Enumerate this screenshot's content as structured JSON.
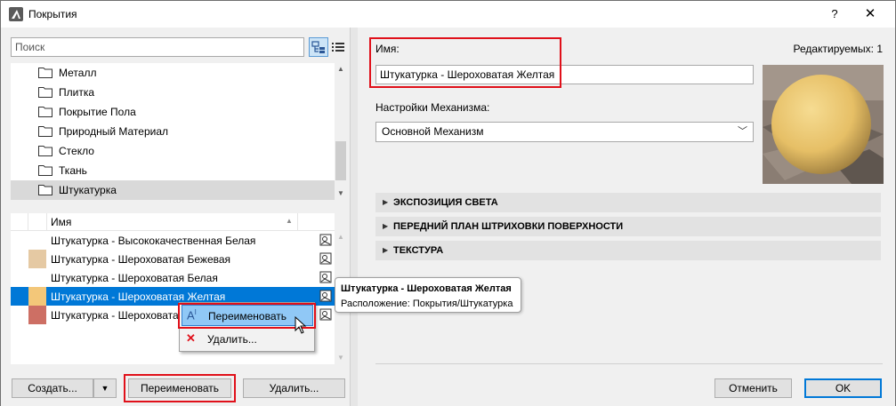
{
  "window": {
    "title": "Покрытия",
    "help_label": "?",
    "close_label": "✕"
  },
  "left": {
    "search_placeholder": "Поиск",
    "folders": [
      "Металл",
      "Плитка",
      "Покрытие Пола",
      "Природный Материал",
      "Стекло",
      "Ткань",
      "Штукатурка"
    ],
    "selected_folder": "Штукатурка",
    "list_header": "Имя",
    "items": [
      {
        "label": "Штукатурка - Высококачественная Белая",
        "color": "#ffffff"
      },
      {
        "label": "Штукатурка - Шероховатая Бежевая",
        "color": "#e5c9a3"
      },
      {
        "label": "Штукатурка - Шероховатая Белая",
        "color": "#ffffff"
      },
      {
        "label": "Штукатурка - Шероховатая Желтая",
        "color": "#f3c779"
      },
      {
        "label": "Штукатурка - Шероховатая",
        "color": "#cd6f64"
      }
    ],
    "selected_item": "Штукатурка - Шероховатая Желтая",
    "buttons": {
      "create": "Создать...",
      "rename": "Переименовать",
      "delete": "Удалить..."
    }
  },
  "right": {
    "name_label": "Имя:",
    "editable_label": "Редактируемых: 1",
    "name_value": "Штукатурка - Шероховатая Желтая",
    "engine_label": "Настройки Механизма:",
    "engine_value": "Основной Механизм",
    "sections": [
      "ЭКСПОЗИЦИЯ СВЕТА",
      "ПЕРЕДНИЙ ПЛАН ШТРИХОВКИ ПОВЕРХНОСТИ",
      "ТЕКСТУРА"
    ],
    "buttons": {
      "cancel": "Отменить",
      "ok": "OK"
    }
  },
  "tooltip": {
    "title": "Штукатурка - Шероховатая Желтая",
    "location": "Расположение: Покрытия/Штукатурка"
  },
  "context_menu": {
    "rename": "Переименовать",
    "delete": "Удалить..."
  },
  "colors": {
    "selection": "#0078d7",
    "highlight_box": "#e0101a",
    "menu_hot": "#90c8f6"
  }
}
